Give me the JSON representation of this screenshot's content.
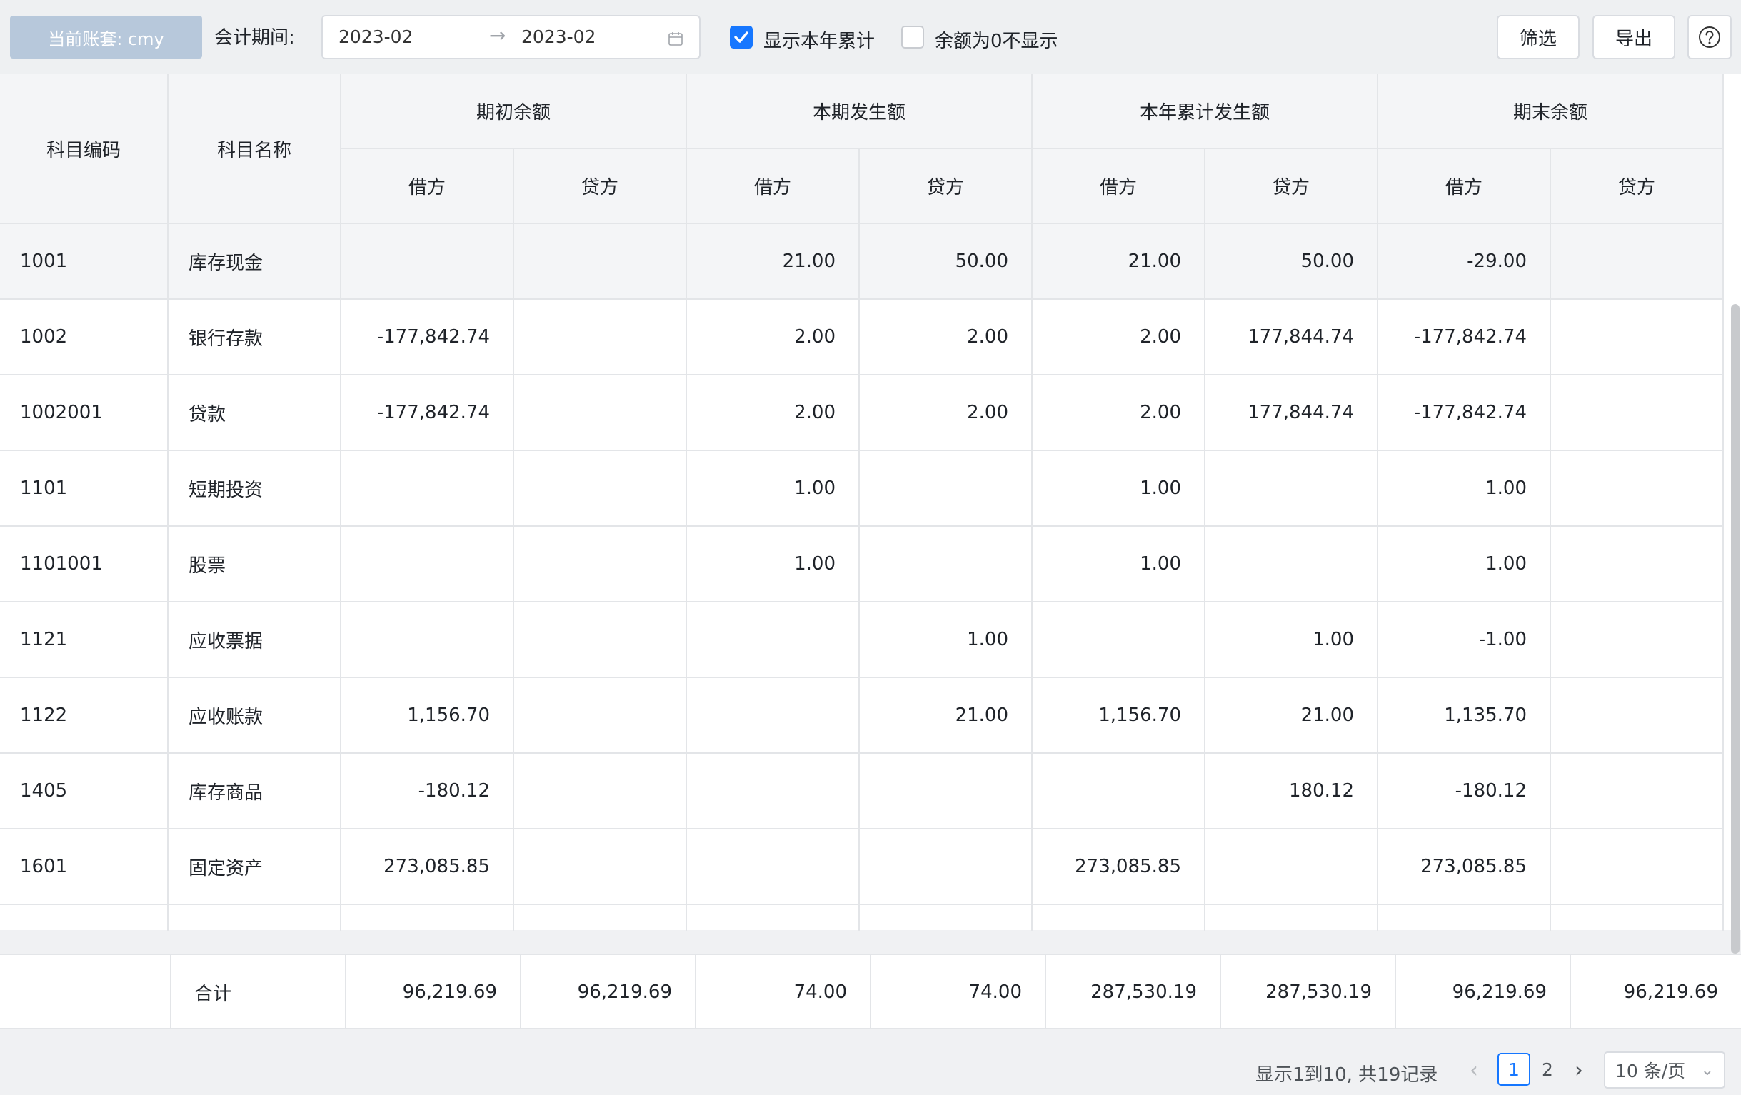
{
  "toolbar": {
    "account_label": "当前账套: cmy",
    "period_label": "会计期间:",
    "period_start": "2023-02",
    "period_arrow": "→",
    "period_end": "2023-02",
    "show_ytd_label": "显示本年累计",
    "show_ytd_checked": true,
    "hide_zero_label": "余额为0不显示",
    "hide_zero_checked": false,
    "filter_label": "筛选",
    "export_label": "导出",
    "help_icon": "question-circle-icon"
  },
  "table": {
    "headers": {
      "code": "科目编码",
      "name": "科目名称",
      "groups": [
        "期初余额",
        "本期发生额",
        "本年累计发生额",
        "期末余额"
      ],
      "debit": "借方",
      "credit": "贷方"
    },
    "rows": [
      {
        "code": "1001",
        "name": "库存现金",
        "v": [
          "",
          "",
          "21.00",
          "50.00",
          "21.00",
          "50.00",
          "-29.00",
          ""
        ]
      },
      {
        "code": "1002",
        "name": "银行存款",
        "v": [
          "-177,842.74",
          "",
          "2.00",
          "2.00",
          "2.00",
          "177,844.74",
          "-177,842.74",
          ""
        ]
      },
      {
        "code": "1002001",
        "name": "贷款",
        "v": [
          "-177,842.74",
          "",
          "2.00",
          "2.00",
          "2.00",
          "177,844.74",
          "-177,842.74",
          ""
        ]
      },
      {
        "code": "1101",
        "name": "短期投资",
        "v": [
          "",
          "",
          "1.00",
          "",
          "1.00",
          "",
          "1.00",
          ""
        ]
      },
      {
        "code": "1101001",
        "name": "股票",
        "v": [
          "",
          "",
          "1.00",
          "",
          "1.00",
          "",
          "1.00",
          ""
        ]
      },
      {
        "code": "1121",
        "name": "应收票据",
        "v": [
          "",
          "",
          "",
          "1.00",
          "",
          "1.00",
          "-1.00",
          ""
        ]
      },
      {
        "code": "1122",
        "name": "应收账款",
        "v": [
          "1,156.70",
          "",
          "",
          "21.00",
          "1,156.70",
          "21.00",
          "1,135.70",
          ""
        ]
      },
      {
        "code": "1405",
        "name": "库存商品",
        "v": [
          "-180.12",
          "",
          "",
          "",
          "",
          "180.12",
          "-180.12",
          ""
        ]
      },
      {
        "code": "1601",
        "name": "固定资产",
        "v": [
          "273,085.85",
          "",
          "",
          "",
          "273,085.85",
          "",
          "273,085.85",
          ""
        ]
      }
    ],
    "total": {
      "label": "合计",
      "v": [
        "96,219.69",
        "96,219.69",
        "74.00",
        "74.00",
        "287,530.19",
        "287,530.19",
        "96,219.69",
        "96,219.69"
      ]
    }
  },
  "pagination": {
    "info": "显示1到10, 共19记录",
    "pages": [
      "1",
      "2"
    ],
    "current": "1",
    "page_size": "10 条/页"
  },
  "colors": {
    "accent": "#1677ff",
    "badge_bg": "#b7c8db",
    "header_bg": "#f4f5f7"
  }
}
